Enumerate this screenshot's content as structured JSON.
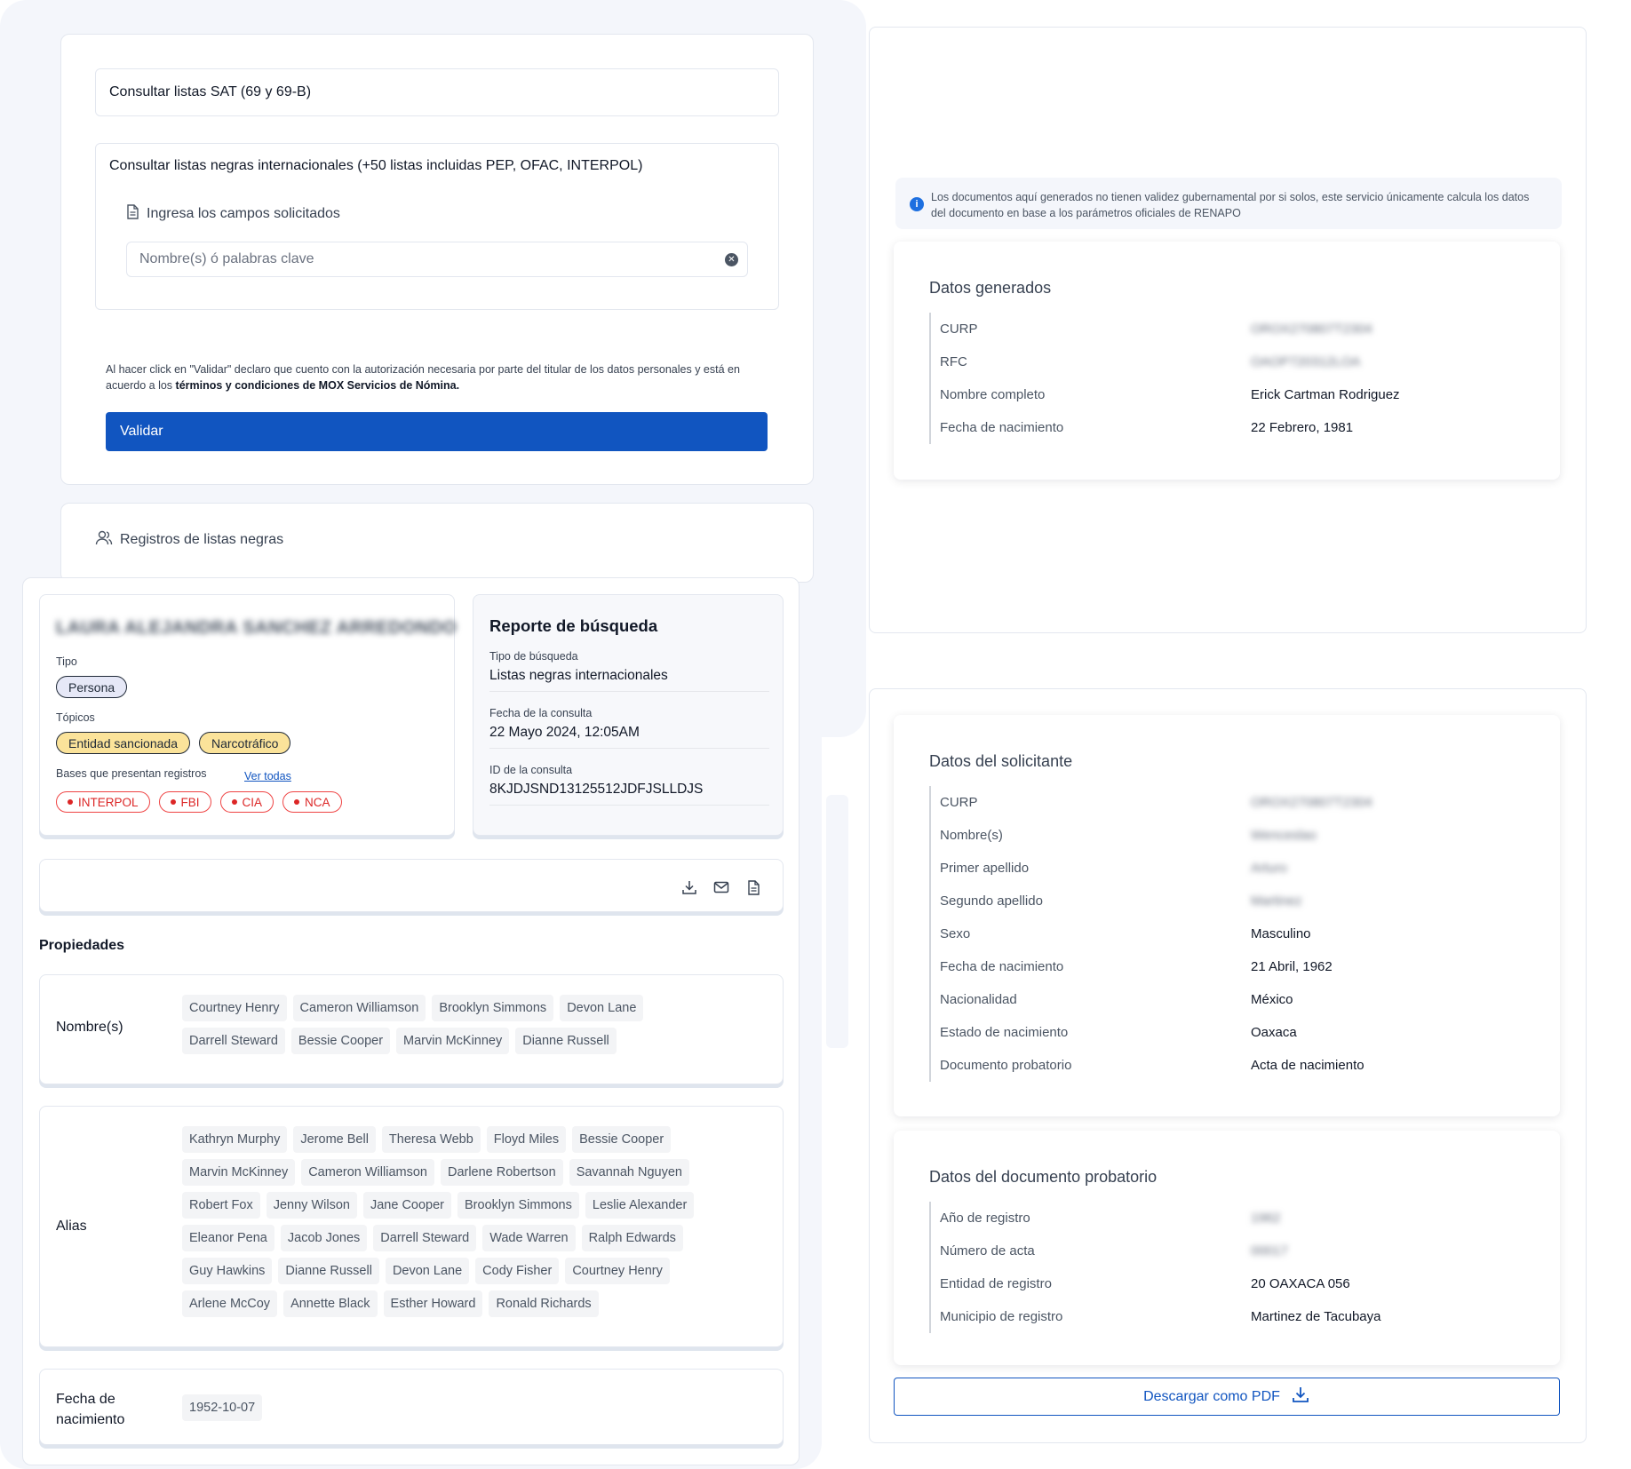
{
  "search": {
    "sat_option": "Consultar listas SAT (69 y 69-B)",
    "intl_option": "Consultar listas negras internacionales (+50 listas incluidas PEP, OFAC, INTERPOL)",
    "fields_hint": "Ingresa los campos solicitados",
    "keyword_placeholder": "Nombre(s) ó palabras clave",
    "keyword_value": "",
    "consent_prefix": "Al hacer click en \"Validar\" declaro que cuento con la autorización necesaria por parte del titular de los datos personales y está en acuerdo a los ",
    "consent_terms": "términos y condiciones de MOX Servicios de Nómina.",
    "validate_label": "Validar"
  },
  "registros": {
    "title": "Registros de listas negras"
  },
  "result": {
    "person_name": "LAURA ALEJANDRA SANCHEZ ARREDONDO",
    "type_label": "Tipo",
    "type_value": "Persona",
    "topics_label": "Tópicos",
    "topics": [
      "Entidad sancionada",
      "Narcotráfico"
    ],
    "bases_label": "Bases que presentan registros",
    "see_all": "Ver todas",
    "bases": [
      "INTERPOL",
      "FBI",
      "CIA",
      "NCA"
    ]
  },
  "report": {
    "title": "Reporte de búsqueda",
    "rows": [
      {
        "label": "Tipo de búsqueda",
        "value": "Listas negras internacionales"
      },
      {
        "label": "Fecha de la consulta",
        "value": "22 Mayo 2024, 12:05AM"
      },
      {
        "label": "ID de la consulta",
        "value": "8KJDJSND13125512JDFJSLLDJS"
      }
    ]
  },
  "actions": {
    "icons": [
      "download-icon",
      "mail-icon",
      "document-icon"
    ]
  },
  "properties": {
    "title": "Propiedades",
    "names_label": "Nombre(s)",
    "names": [
      "Courtney Henry",
      "Cameron Williamson",
      "Brooklyn Simmons",
      "Devon Lane",
      "Darrell Steward",
      "Bessie Cooper",
      "Marvin McKinney",
      "Dianne Russell"
    ],
    "alias_label": "Alias",
    "aliases": [
      "Kathryn Murphy",
      "Jerome Bell",
      "Theresa Webb",
      "Floyd Miles",
      "Bessie Cooper",
      "Marvin McKinney",
      "Cameron Williamson",
      "Darlene Robertson",
      "Savannah Nguyen",
      "Robert Fox",
      "Jenny Wilson",
      "Jane Cooper",
      "Brooklyn Simmons",
      "Leslie Alexander",
      "Eleanor Pena",
      "Jacob Jones",
      "Darrell Steward",
      "Wade Warren",
      "Ralph Edwards",
      "Guy Hawkins",
      "Dianne Russell",
      "Devon Lane",
      "Cody Fisher",
      "Courtney Henry",
      "Arlene McCoy",
      "Annette Black",
      "Esther Howard",
      "Ronald Richards"
    ],
    "dob_label_line1": "Fecha de",
    "dob_label_line2": "nacimiento",
    "dob_value": "1952-10-07"
  },
  "notice": {
    "text": "Los documentos aquí generados no tienen validez gubernamental por si solos, este servicio únicamente calcula los datos del documento en base a los parámetros oficiales de RENAPO"
  },
  "generated": {
    "title": "Datos generados",
    "rows": [
      {
        "key": "CURP",
        "value": "OROX270807T2304",
        "blurred": true
      },
      {
        "key": "RFC",
        "value": "OAOP720312LOA",
        "blurred": true
      },
      {
        "key": "Nombre completo",
        "value": "Erick Cartman Rodriguez",
        "blurred": false
      },
      {
        "key": "Fecha de nacimiento",
        "value": "22 Febrero, 1981",
        "blurred": false
      }
    ]
  },
  "applicant": {
    "title": "Datos del solicitante",
    "rows": [
      {
        "key": "CURP",
        "value": "OROX270807T2304",
        "blurred": true
      },
      {
        "key": "Nombre(s)",
        "value": "Wenceslao",
        "blurred": true
      },
      {
        "key": "Primer apellido",
        "value": "Arturo",
        "blurred": true
      },
      {
        "key": "Segundo apellido",
        "value": "Martinez",
        "blurred": true
      },
      {
        "key": "Sexo",
        "value": "Masculino",
        "blurred": false
      },
      {
        "key": "Fecha de nacimiento",
        "value": "21 Abril, 1962",
        "blurred": false
      },
      {
        "key": "Nacionalidad",
        "value": "México",
        "blurred": false
      },
      {
        "key": "Estado de nacimiento",
        "value": "Oaxaca",
        "blurred": false
      },
      {
        "key": "Documento probatorio",
        "value": "Acta de nacimiento",
        "blurred": false
      }
    ]
  },
  "proof": {
    "title": "Datos del documento probatorio",
    "rows": [
      {
        "key": "Año de registro",
        "value": "1962",
        "blurred": true
      },
      {
        "key": "Número de acta",
        "value": "00017",
        "blurred": true
      },
      {
        "key": "Entidad de registro",
        "value": "20 OAXACA 056",
        "blurred": false
      },
      {
        "key": "Municipio de registro",
        "value": "Martinez de Tacubaya",
        "blurred": false
      }
    ]
  },
  "pdf": {
    "label": "Descargar como PDF"
  },
  "colors": {
    "primary": "#1155c0",
    "panel_bg": "#f4f6fb",
    "topic_pill": "#fbe39a",
    "base_pill": "#dc2626",
    "type_pill": "#e6e8f7"
  }
}
